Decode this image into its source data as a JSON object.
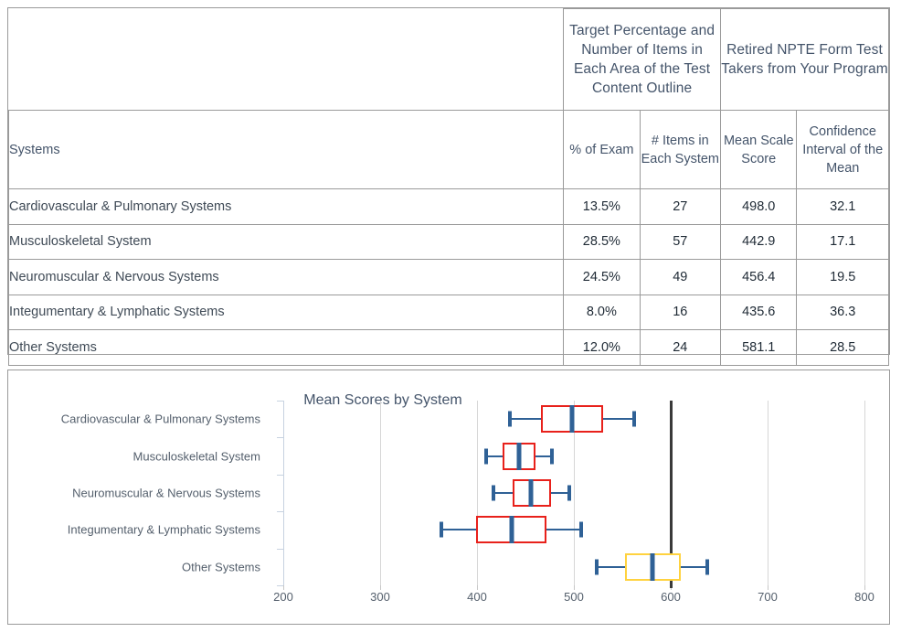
{
  "table": {
    "header_groups": [
      {
        "label": "",
        "name": "blank-header"
      },
      {
        "label": "Target Percentage and Number of Items in Each Area of the Test Content Outline",
        "name": "target-group-header"
      },
      {
        "label": "Retired NPTE Form Test Takers from Your Program",
        "name": "retired-group-header"
      }
    ],
    "columns": {
      "systems": "Systems",
      "pct_of_exam": "% of Exam",
      "items_each_system": "# Items in Each System",
      "mean_scale_score": "Mean Scale Score",
      "confidence_interval": "Confidence Interval of the Mean"
    },
    "rows": [
      {
        "system": "Cardiovascular & Pulmonary Systems",
        "pct": "13.5%",
        "items": "27",
        "mean": "498.0",
        "ci": "32.1"
      },
      {
        "system": "Musculoskeletal System",
        "pct": "28.5%",
        "items": "57",
        "mean": "442.9",
        "ci": "17.1"
      },
      {
        "system": "Neuromuscular & Nervous Systems",
        "pct": "24.5%",
        "items": "49",
        "mean": "456.4",
        "ci": "19.5"
      },
      {
        "system": "Integumentary & Lymphatic Systems",
        "pct": "8.0%",
        "items": "16",
        "mean": "435.6",
        "ci": "36.3"
      },
      {
        "system": "Other Systems",
        "pct": "12.0%",
        "items": "24",
        "mean": "581.1",
        "ci": "28.5"
      }
    ]
  },
  "chart_data": {
    "type": "boxplot",
    "title": "Mean Scores by System",
    "xlabel": "",
    "ylabel": "",
    "xlim": [
      200,
      800
    ],
    "xticks": [
      200,
      300,
      400,
      500,
      600,
      700,
      800
    ],
    "xtick_labels": [
      "200",
      "300",
      "400",
      "500",
      "600",
      "700",
      "800"
    ],
    "grid": true,
    "legend": "none",
    "reference_line": {
      "value": 600,
      "color": "#3a3a3a",
      "label": ""
    },
    "categories": [
      "Cardiovascular & Pulmonary Systems",
      "Musculoskeletal System",
      "Neuromuscular & Nervous Systems",
      "Integumentary & Lymphatic Systems",
      "Other Systems"
    ],
    "boxes": [
      {
        "category": "Cardiovascular & Pulmonary Systems",
        "whisker_low": 434,
        "q1": 466,
        "median": 498,
        "q3": 530,
        "whisker_high": 562,
        "box_color": "#e8211b",
        "median_color": "#2f6196",
        "whisker_color": "#2f6196"
      },
      {
        "category": "Musculoskeletal System",
        "whisker_low": 409,
        "q1": 426,
        "median": 443,
        "q3": 460,
        "whisker_high": 477,
        "box_color": "#e8211b",
        "median_color": "#2f6196",
        "whisker_color": "#2f6196"
      },
      {
        "category": "Neuromuscular & Nervous Systems",
        "whisker_low": 417,
        "q1": 437,
        "median": 456,
        "q3": 476,
        "whisker_high": 495,
        "box_color": "#e8211b",
        "median_color": "#2f6196",
        "whisker_color": "#2f6196"
      },
      {
        "category": "Integumentary & Lymphatic Systems",
        "whisker_low": 363,
        "q1": 399,
        "median": 436,
        "q3": 472,
        "whisker_high": 508,
        "box_color": "#e8211b",
        "median_color": "#2f6196",
        "whisker_color": "#2f6196"
      },
      {
        "category": "Other Systems",
        "whisker_low": 524,
        "q1": 553,
        "median": 581,
        "q3": 610,
        "whisker_high": 638,
        "box_color": "#ffd23f",
        "median_color": "#2f6196",
        "whisker_color": "#2f6196"
      }
    ]
  },
  "colors": {
    "border": "#9a9a9a",
    "header_text": "#44546a",
    "body_text": "#3f4a56",
    "gridline": "#d6d6d6",
    "box_red": "#e8211b",
    "box_yellow": "#ffd23f",
    "whisker_blue": "#2f6196",
    "reference_line": "#3a3a3a"
  }
}
